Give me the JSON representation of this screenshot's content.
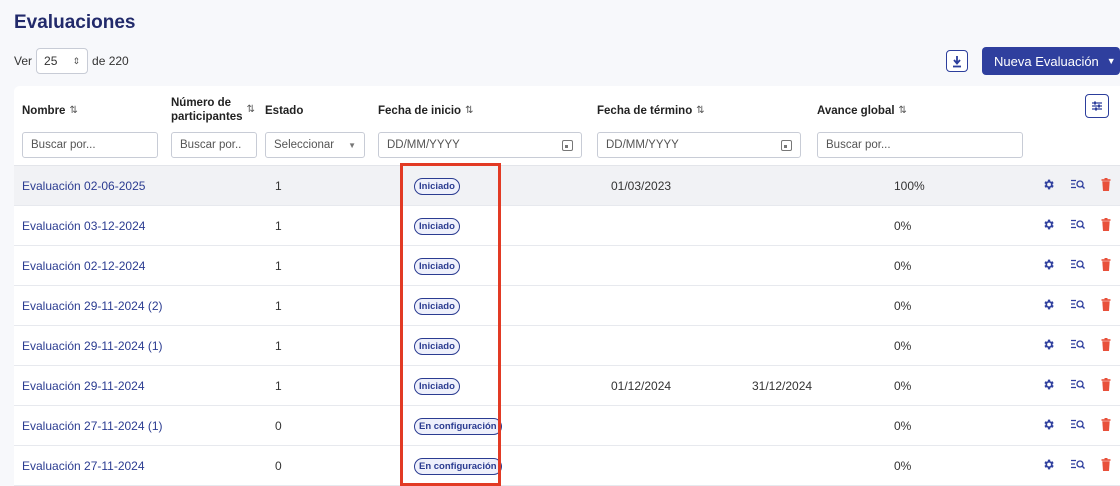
{
  "page": {
    "title": "Evaluaciones"
  },
  "toolbar": {
    "ver_label": "Ver",
    "per_page": "25",
    "of_total": "de 220",
    "new_button": "Nueva Evaluación"
  },
  "columns": {
    "nombre": "Nombre",
    "participantes_line1": "Número de",
    "participantes_line2": "participantes",
    "estado": "Estado",
    "fecha_inicio": "Fecha de inicio",
    "fecha_termino": "Fecha de término",
    "avance": "Avance global"
  },
  "filters": {
    "nombre_placeholder": "Buscar por...",
    "participantes_placeholder": "Buscar por..",
    "estado_placeholder": "Seleccionar",
    "inicio_placeholder": "DD/MM/YYYY",
    "termino_placeholder": "DD/MM/YYYY",
    "avance_placeholder": "Buscar por..."
  },
  "rows": [
    {
      "name": "Evaluación 02-06-2025",
      "participants": "1",
      "status": "Iniciado",
      "start": "01/03/2023",
      "end": "",
      "progress": "100%"
    },
    {
      "name": "Evaluación 03-12-2024",
      "participants": "1",
      "status": "Iniciado",
      "start": "",
      "end": "",
      "progress": "0%"
    },
    {
      "name": "Evaluación 02-12-2024",
      "participants": "1",
      "status": "Iniciado",
      "start": "",
      "end": "",
      "progress": "0%"
    },
    {
      "name": "Evaluación 29-11-2024 (2)",
      "participants": "1",
      "status": "Iniciado",
      "start": "",
      "end": "",
      "progress": "0%"
    },
    {
      "name": "Evaluación 29-11-2024 (1)",
      "participants": "1",
      "status": "Iniciado",
      "start": "",
      "end": "",
      "progress": "0%"
    },
    {
      "name": "Evaluación 29-11-2024",
      "participants": "1",
      "status": "Iniciado",
      "start": "01/12/2024",
      "end": "31/12/2024",
      "progress": "0%"
    },
    {
      "name": "Evaluación 27-11-2024 (1)",
      "participants": "0",
      "status": "En configuración",
      "start": "",
      "end": "",
      "progress": "0%"
    },
    {
      "name": "Evaluación 27-11-2024",
      "participants": "0",
      "status": "En configuración",
      "start": "",
      "end": "",
      "progress": "0%"
    }
  ],
  "colors": {
    "primary": "#2f3f9e",
    "highlight": "#e23a24",
    "delete": "#e8503a"
  },
  "icons": {
    "row_actions": [
      "gear-icon",
      "search-list-icon",
      "trash-icon"
    ]
  }
}
